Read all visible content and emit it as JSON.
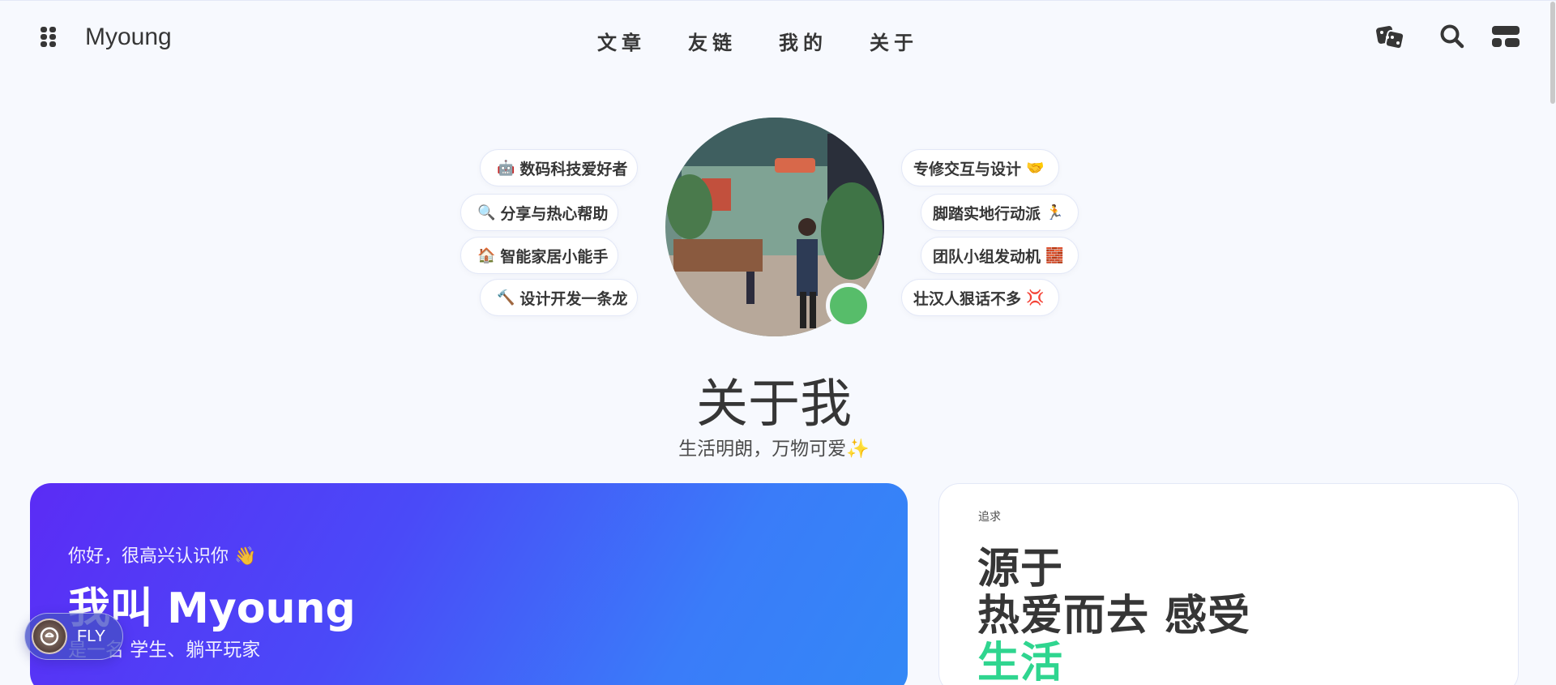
{
  "header": {
    "brand": "Myoung",
    "nav_items": [
      {
        "label": "文章"
      },
      {
        "label": "友链"
      },
      {
        "label": "我的"
      },
      {
        "label": "关于"
      }
    ],
    "icons": [
      "menu-grid-icon",
      "dice-icon",
      "search-icon",
      "layout-toggle-icon"
    ]
  },
  "hero": {
    "tags_left": [
      {
        "label": "数码科技爱好者",
        "emoji": "🤖"
      },
      {
        "label": "分享与热心帮助",
        "emoji": "🔍"
      },
      {
        "label": "智能家居小能手",
        "emoji": "🏠"
      },
      {
        "label": "设计开发一条龙",
        "emoji": "🔨"
      }
    ],
    "tags_right": [
      {
        "label": "专修交互与设计",
        "emoji": "🤝"
      },
      {
        "label": "脚踏实地行动派",
        "emoji": "🏃"
      },
      {
        "label": "团队小组发动机",
        "emoji": "🧱"
      },
      {
        "label": "壮汉人狠话不多",
        "emoji": "💢"
      }
    ],
    "status_color": "#57bd6a",
    "title": "关于我",
    "subtitle": "生活明朗，万物可爱✨"
  },
  "hello_card": {
    "greeting": "你好，很高兴认识你 👋",
    "name": "我叫 Myoung",
    "roles": "是一名 学生、躺平玩家",
    "gradient": [
      "#5b2cf5",
      "#3388f6"
    ]
  },
  "goal_card": {
    "tip": "追求",
    "line1": "源于",
    "line2": "热爱而去 感受",
    "line3": "生活",
    "highlight_color": "#2fd58f"
  },
  "fly_pill": {
    "label": "FLY"
  }
}
